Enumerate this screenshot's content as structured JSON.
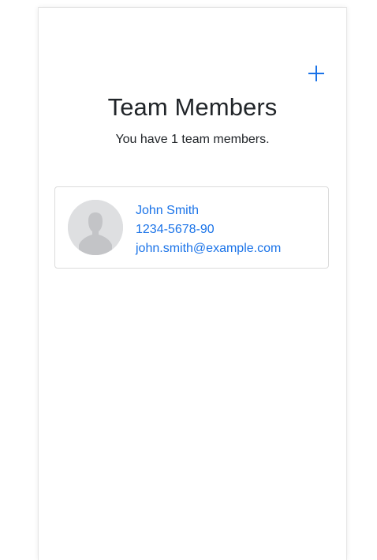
{
  "header": {
    "title": "Team Members",
    "subtitle": "You have 1 team members.",
    "add_icon": "plus-icon"
  },
  "members": [
    {
      "name": "John Smith",
      "phone": "1234-5678-90",
      "email": "john.smith@example.com",
      "avatar_icon": "person-placeholder-icon"
    }
  ],
  "colors": {
    "accent": "#1a73e8",
    "text": "#212529",
    "avatar_bg": "#dedfe1",
    "border": "#dcdcdc"
  }
}
